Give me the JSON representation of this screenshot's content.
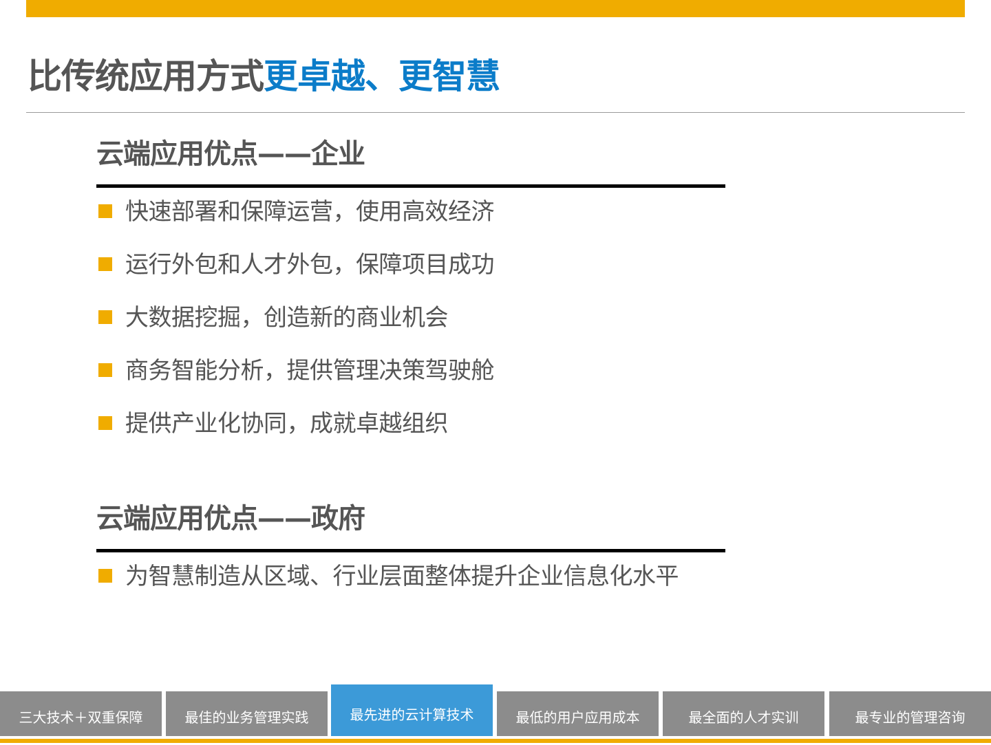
{
  "title": {
    "main": "比传统应用方式",
    "accent": "更卓越、更智慧"
  },
  "sections": [
    {
      "heading": "云端应用优点——企业",
      "items": [
        "快速部署和保障运营，使用高效经济",
        "运行外包和人才外包，保障项目成功",
        "大数据挖掘，创造新的商业机会",
        "商务智能分析，提供管理决策驾驶舱",
        "提供产业化协同，成就卓越组织"
      ]
    },
    {
      "heading": "云端应用优点——政府",
      "items": [
        "为智慧制造从区域、行业层面整体提升企业信息化水平"
      ]
    }
  ],
  "nav": {
    "tabs": [
      "三大技术＋双重保障",
      "最佳的业务管理实践",
      "最先进的云计算技术",
      "最低的用户应用成本",
      "最全面的人才实训",
      "最专业的管理咨询"
    ],
    "active_index": 2
  },
  "colors": {
    "accent_orange": "#F0AC00",
    "accent_blue": "#0B7CC9",
    "tab_gray": "#8C8C8C",
    "tab_active_blue": "#3C9AD8",
    "text_gray": "#555555"
  }
}
